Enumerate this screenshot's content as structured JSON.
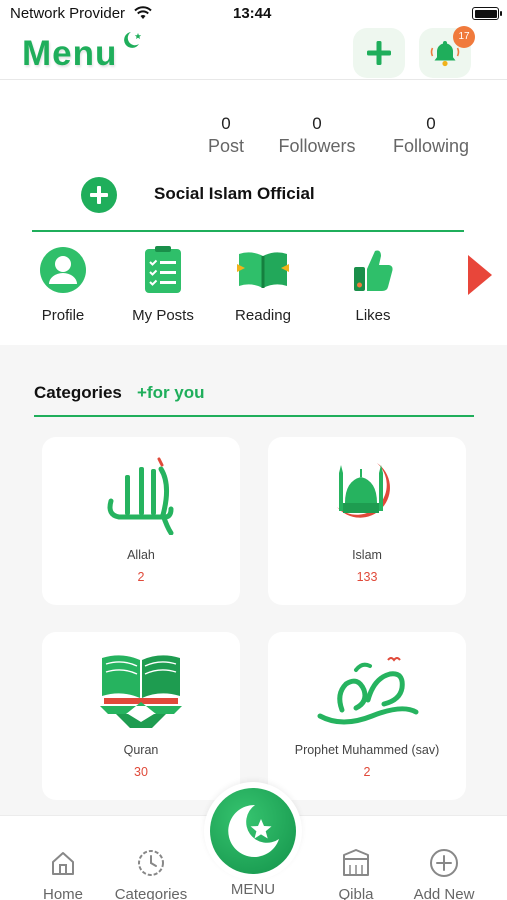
{
  "status_bar": {
    "carrier": "Network Provider",
    "time": "13:44"
  },
  "header": {
    "title": "Menu",
    "notification_count": "17"
  },
  "profile": {
    "stats": [
      {
        "value": "0",
        "label": "Post"
      },
      {
        "value": "0",
        "label": "Followers"
      },
      {
        "value": "0",
        "label": "Following"
      }
    ],
    "account_name": "Social Islam Official"
  },
  "quick_menu": [
    {
      "label": "Profile",
      "icon": "user-icon"
    },
    {
      "label": "My Posts",
      "icon": "clipboard-list-icon"
    },
    {
      "label": "Reading",
      "icon": "open-book-icon"
    },
    {
      "label": "Likes",
      "icon": "thumbs-up-icon"
    }
  ],
  "categories": {
    "title": "Categories",
    "subtitle": "+for you",
    "items": [
      {
        "name": "Allah",
        "count": "2",
        "icon": "allah-calligraphy-icon"
      },
      {
        "name": "Islam",
        "count": "133",
        "icon": "mosque-crescent-icon"
      },
      {
        "name": "Quran",
        "count": "30",
        "icon": "quran-stand-icon"
      },
      {
        "name": "Prophet Muhammed (sav)",
        "count": "2",
        "icon": "muhammad-calligraphy-icon"
      }
    ]
  },
  "tab_bar": {
    "home": "Home",
    "categories": "Categories",
    "menu": "MENU",
    "qibla": "Qibla",
    "add_new": "Add New"
  },
  "colors": {
    "accent": "#1fae5b",
    "count": "#e04a3a",
    "badge": "#f07a3c",
    "arrow": "#e8463a"
  }
}
